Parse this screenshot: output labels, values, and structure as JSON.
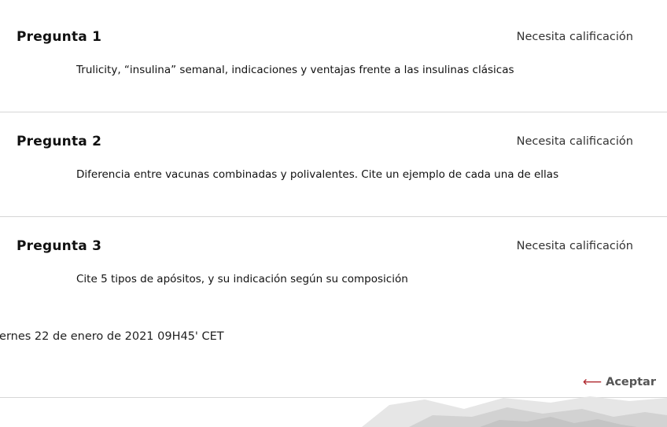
{
  "questions": [
    {
      "title": "Pregunta 1",
      "status": "Necesita calificación",
      "text": "Trulicity, “insulina” semanal, indicaciones y ventajas frente a las insulinas clásicas"
    },
    {
      "title": "Pregunta 2",
      "status": "Necesita calificación",
      "text": "Diferencia entre vacunas combinadas y polivalentes. Cite un ejemplo de cada una de ellas"
    },
    {
      "title": "Pregunta 3",
      "status": "Necesita calificación",
      "text": "Cite 5 tipos de apósitos, y su indicación según su composición"
    }
  ],
  "submission_date": "iernes 22 de enero de 2021 09H45' CET",
  "accept_button": {
    "icon": "arrow-left-icon",
    "label": "Aceptar"
  },
  "colors": {
    "accent_arrow": "#b02a30",
    "divider": "#d6d6d6",
    "watermark": "#e6e6e6"
  }
}
